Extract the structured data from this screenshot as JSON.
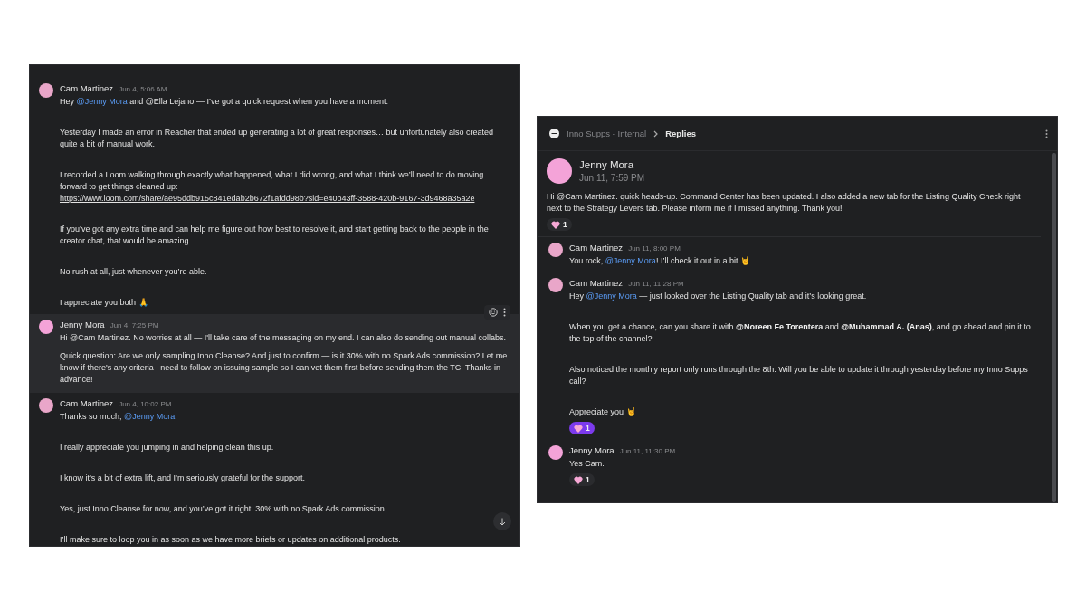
{
  "channel_view": {
    "messages": [
      {
        "author": "Cam Martinez",
        "time": "Jun 4, 5:06 AM",
        "color": "#e9a6c9",
        "hovered": false,
        "paragraphs": [
          [
            {
              "kind": "text",
              "text": "Hey "
            },
            {
              "kind": "mention",
              "text": "@Jenny Mora"
            },
            {
              "kind": "text",
              "text": " and @Ella Lejano — I’ve got a quick request when you have a moment."
            }
          ],
          [
            {
              "kind": "text",
              "text": "Yesterday I made an error in Reacher that ended up generating a lot of great responses… but unfortunately also created quite a bit of manual work."
            }
          ],
          [
            {
              "kind": "text",
              "text": "I recorded a Loom walking through exactly what happened, what I did wrong, and what I think we’ll need to do moving forward to get things cleaned up: "
            },
            {
              "kind": "link",
              "text": "https://www.loom.com/share/ae95ddb915c841edab2b672f1afdd98b?sid=e40b43ff-3588-420b-9167-3d9468a35a2e"
            }
          ],
          [
            {
              "kind": "text",
              "text": "If you’ve got any extra time and can help me figure out how best to resolve it, and start getting back to the people in the creator chat, that would be amazing."
            }
          ],
          [
            {
              "kind": "text",
              "text": "No rush at all, just whenever you’re able."
            }
          ],
          [
            {
              "kind": "text",
              "text": "I appreciate you both 🙏"
            }
          ]
        ]
      },
      {
        "author": "Jenny Mora",
        "time": "Jun 4, 7:25 PM",
        "color": "#f4a3d8",
        "hovered": true,
        "paragraphs": [
          [
            {
              "kind": "text",
              "text": "Hi @Cam Martinez. No worries at all — I'll take care of the messaging on my end. I can also do sending out manual collabs."
            }
          ]
        ]
      },
      {
        "hovered": true,
        "paragraphs": [
          [
            {
              "kind": "text",
              "text": "Quick question: Are we only sampling Inno Cleanse? And just to confirm — is it 30% with no Spark Ads commission? Let me know if there's any criteria I need to follow on issuing sample so I can vet them first before sending them the TC. Thanks in advance!"
            }
          ]
        ]
      },
      {
        "author": "Cam Martinez",
        "time": "Jun 4, 10:02 PM",
        "color": "#e9a6c9",
        "hovered": false,
        "paragraphs": [
          [
            {
              "kind": "text",
              "text": "Thanks so much, "
            },
            {
              "kind": "mention",
              "text": "@Jenny Mora"
            },
            {
              "kind": "text",
              "text": "!"
            }
          ],
          [
            {
              "kind": "text",
              "text": "I really appreciate you jumping in and helping clean this up."
            }
          ],
          [
            {
              "kind": "text",
              "text": "I know it’s a bit of extra lift, and I’m seriously grateful for the support."
            }
          ],
          [
            {
              "kind": "text",
              "text": "Yes, just Inno Cleanse for now, and you’ve got it right: 30% with no Spark Ads commission."
            }
          ],
          [
            {
              "kind": "text",
              "text": "I’ll make sure to loop you in as soon as we have more briefs or updates on additional products."
            }
          ]
        ]
      }
    ]
  },
  "thread_view": {
    "breadcrumb": {
      "channel": "Inno Supps - Internal",
      "current": "Replies"
    },
    "parent": {
      "author": "Jenny Mora",
      "time": "Jun 11, 7:59 PM",
      "color": "#f4a3d8",
      "paragraphs": [
        [
          {
            "kind": "text",
            "text": "Hi @Cam Martinez. quick heads-up. Command Center has been updated. I also added a new tab for the Listing Quality Check right next to the Strategy Levers tab. Please inform me if I missed anything. Thank you!"
          }
        ]
      ],
      "reactions": [
        {
          "count": "1",
          "selected": false
        }
      ]
    },
    "replies": [
      {
        "author": "Cam Martinez",
        "time": "Jun 11, 8:00 PM",
        "color": "#e9a6c9",
        "paragraphs": [
          [
            {
              "kind": "text",
              "text": "You rock, "
            },
            {
              "kind": "mention",
              "text": "@Jenny Mora"
            },
            {
              "kind": "text",
              "text": "! I’ll check it out in a bit 🤘"
            }
          ]
        ]
      },
      {
        "author": "Cam Martinez",
        "time": "Jun 11, 11:28 PM",
        "color": "#e9a6c9",
        "paragraphs": [
          [
            {
              "kind": "text",
              "text": "Hey "
            },
            {
              "kind": "mention",
              "text": "@Jenny Mora"
            },
            {
              "kind": "text",
              "text": " — just looked over the Listing Quality tab and it’s looking great."
            }
          ],
          [
            {
              "kind": "text",
              "text": "When you get a chance, can you share it with "
            },
            {
              "kind": "strong",
              "text": "@Noreen Fe Torentera"
            },
            {
              "kind": "text",
              "text": " and "
            },
            {
              "kind": "strong",
              "text": "@Muhammad A. (Anas)"
            },
            {
              "kind": "text",
              "text": ", and go ahead and pin it to the top of the channel?"
            }
          ],
          [
            {
              "kind": "text",
              "text": "Also noticed the monthly report only runs through the 8th. Will you be able to update it through yesterday before my Inno Supps call?"
            }
          ],
          [
            {
              "kind": "text",
              "text": "Appreciate you 🤘"
            }
          ]
        ],
        "reactions": [
          {
            "count": "1",
            "selected": true
          }
        ]
      },
      {
        "author": "Jenny Mora",
        "time": "Jun 11, 11:30 PM",
        "color": "#f4a3d8",
        "paragraphs": [
          [
            {
              "kind": "text",
              "text": "Yes Cam."
            }
          ]
        ],
        "reactions": [
          {
            "count": "1",
            "selected": false
          }
        ]
      }
    ]
  }
}
